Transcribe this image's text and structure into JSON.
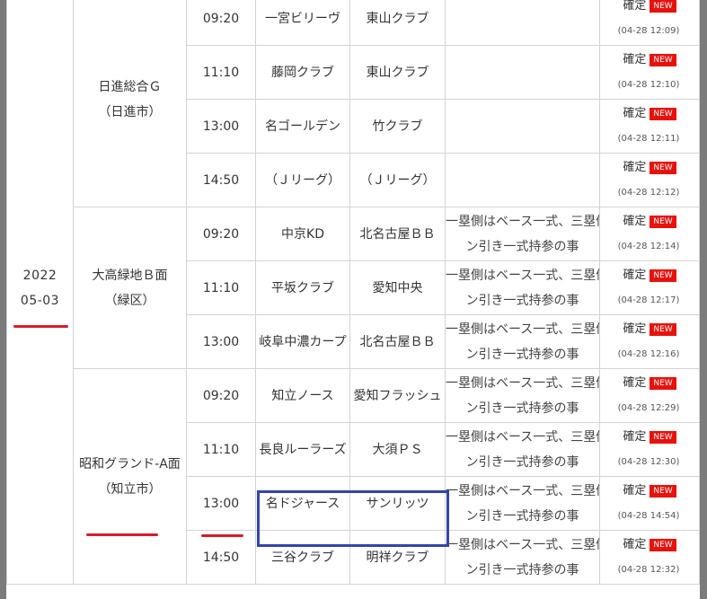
{
  "date": {
    "year": "2022",
    "monthday": "05-03"
  },
  "venues": [
    {
      "name": "日進総合Ｇ",
      "area": "（日進市）"
    },
    {
      "name": "大高緑地Ｂ面",
      "area": "（緑区）"
    },
    {
      "name": "昭和グランド-A面",
      "area": "（知立市）"
    }
  ],
  "note_line1": "一塁側はベース一式、三塁側はライ",
  "note_line2": "ン引き一式持参の事",
  "status_label": "確定",
  "badge_label": "NEW",
  "matches": [
    {
      "time": "09:20",
      "home": "一宮ビリーヴ",
      "away": "東山クラブ",
      "updated": "(04-28 12:09)"
    },
    {
      "time": "11:10",
      "home": "藤岡クラブ",
      "away": "東山クラブ",
      "updated": "(04-28 12:10)"
    },
    {
      "time": "13:00",
      "home": "名ゴールデン",
      "away": "竹クラブ",
      "updated": "(04-28 12:11)"
    },
    {
      "time": "14:50",
      "home": "（Ｊリーグ）",
      "away": "（Ｊリーグ）",
      "updated": "(04-28 12:12)"
    },
    {
      "time": "09:20",
      "home": "中京KD",
      "away": "北名古屋ＢＢ",
      "updated": "(04-28 12:14)"
    },
    {
      "time": "11:10",
      "home": "平坂クラブ",
      "away": "愛知中央",
      "updated": "(04-28 12:17)"
    },
    {
      "time": "13:00",
      "home": "岐阜中濃カープ",
      "away": "北名古屋ＢＢ",
      "updated": "(04-28 12:16)"
    },
    {
      "time": "09:20",
      "home": "知立ノース",
      "away": "愛知フラッシュ",
      "updated": "(04-28 12:29)"
    },
    {
      "time": "11:10",
      "home": "長良ルーラーズ",
      "away": "大須ＰＳ",
      "updated": "(04-28 12:30)"
    },
    {
      "time": "13:00",
      "home": "名ドジャース",
      "away": "サンリッツ",
      "updated": "(04-28 14:54)"
    },
    {
      "time": "14:50",
      "home": "三谷クラブ",
      "away": "明祥クラブ",
      "updated": "(04-28 12:32)"
    }
  ]
}
